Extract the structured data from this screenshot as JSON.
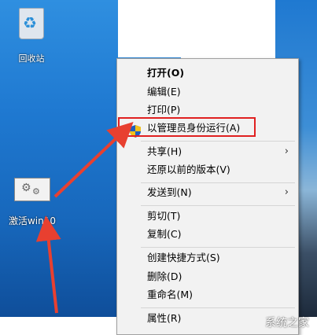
{
  "desktop": {
    "icons": [
      {
        "label": "回收站",
        "icon": "recycle-bin-icon"
      },
      {
        "label": "激活win10",
        "icon": "gear-shortcut-icon"
      }
    ]
  },
  "context_menu": {
    "items": [
      {
        "label": "打开(O)",
        "bold": true
      },
      {
        "label": "编辑(E)"
      },
      {
        "label": "打印(P)"
      },
      {
        "label": "以管理员身份运行(A)",
        "icon": "uac-shield-icon",
        "highlighted": true
      },
      {
        "label": "共享(H)",
        "submenu": true
      },
      {
        "label": "还原以前的版本(V)"
      },
      {
        "label": "发送到(N)",
        "submenu": true
      },
      {
        "label": "剪切(T)"
      },
      {
        "label": "复制(C)"
      },
      {
        "label": "创建快捷方式(S)"
      },
      {
        "label": "删除(D)"
      },
      {
        "label": "重命名(M)"
      },
      {
        "label": "属性(R)"
      }
    ]
  },
  "colors": {
    "highlight_border": "#e02020",
    "arrow": "#e84030",
    "menu_bg": "#f2f2f2"
  },
  "watermark": "系统之家"
}
